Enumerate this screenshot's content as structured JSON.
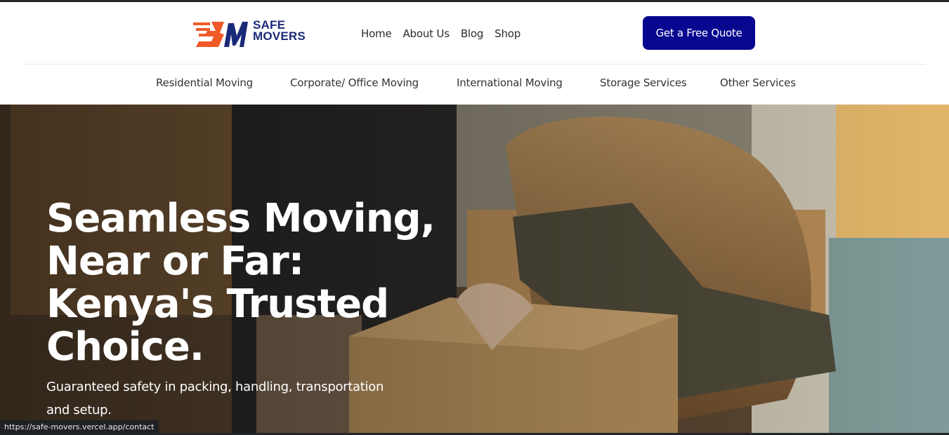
{
  "brand": {
    "logo_line1": "SAFE",
    "logo_line2": "MOVERS",
    "colors": {
      "navy": "#1b2a78",
      "orange": "#f05a28"
    }
  },
  "main_nav": [
    {
      "label": "Home"
    },
    {
      "label": "About Us"
    },
    {
      "label": "Blog"
    },
    {
      "label": "Shop"
    }
  ],
  "cta": {
    "label": "Get a Free Quote",
    "color": "#07078f"
  },
  "services_nav": [
    {
      "label": "Residential Moving"
    },
    {
      "label": "Corporate/ Office Moving"
    },
    {
      "label": "International Moving"
    },
    {
      "label": "Storage Services"
    },
    {
      "label": "Other Services"
    }
  ],
  "hero": {
    "title": "Seamless Moving, Near or Far: Kenya's Trusted Choice.",
    "subtitle": "Guaranteed safety in packing, handling, transportation and setup."
  },
  "status_bar": {
    "url": "https://safe-movers.vercel.app/contact"
  }
}
